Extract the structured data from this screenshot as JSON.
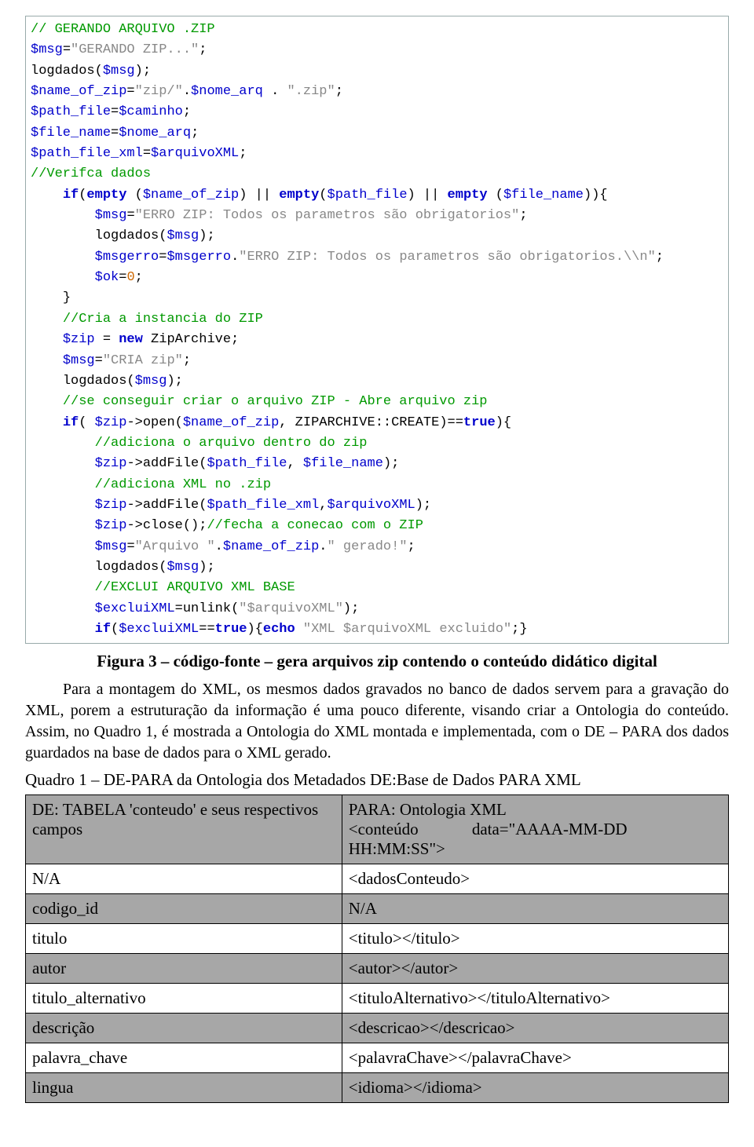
{
  "code_html": "<span class=\"c-comment\">// GERANDO ARQUIVO .ZIP</span>\n<span class=\"c-var\">$msg</span><span class=\"c-plain\">=</span><span class=\"c-str\">\"GERANDO ZIP...\"</span><span class=\"c-plain\">;</span>\n<span class=\"c-plain\">logdados(</span><span class=\"c-var\">$msg</span><span class=\"c-plain\">);</span>\n<span class=\"c-var\">$name_of_zip</span><span class=\"c-plain\">=</span><span class=\"c-str\">\"zip/\"</span><span class=\"c-plain\">.</span><span class=\"c-var\">$nome_arq</span><span class=\"c-plain\"> . </span><span class=\"c-str\">\".zip\"</span><span class=\"c-plain\">;</span>\n<span class=\"c-var\">$path_file</span><span class=\"c-plain\">=</span><span class=\"c-var\">$caminho</span><span class=\"c-plain\">;</span>\n<span class=\"c-var\">$file_name</span><span class=\"c-plain\">=</span><span class=\"c-var\">$nome_arq</span><span class=\"c-plain\">;</span>\n<span class=\"c-var\">$path_file_xml</span><span class=\"c-plain\">=</span><span class=\"c-var\">$arquivoXML</span><span class=\"c-plain\">;</span>\n<span class=\"c-comment\">//Verifca dados</span>\n    <span class=\"c-kw\">if</span><span class=\"c-plain\">(</span><span class=\"c-kw\">empty</span><span class=\"c-plain\"> (</span><span class=\"c-var\">$name_of_zip</span><span class=\"c-plain\">) || </span><span class=\"c-kw\">empty</span><span class=\"c-plain\">(</span><span class=\"c-var\">$path_file</span><span class=\"c-plain\">) || </span><span class=\"c-kw\">empty</span><span class=\"c-plain\"> (</span><span class=\"c-var\">$file_name</span><span class=\"c-plain\">)){</span>\n        <span class=\"c-var\">$msg</span><span class=\"c-plain\">=</span><span class=\"c-str\">\"ERRO ZIP: Todos os parametros são obrigatorios\"</span><span class=\"c-plain\">;</span>\n        <span class=\"c-plain\">logdados(</span><span class=\"c-var\">$msg</span><span class=\"c-plain\">);</span>\n        <span class=\"c-var\">$msgerro</span><span class=\"c-plain\">=</span><span class=\"c-var\">$msgerro</span><span class=\"c-plain\">.</span><span class=\"c-str\">\"ERRO ZIP: Todos os parametros são obrigatorios.\\\\n\"</span><span class=\"c-plain\">;</span>\n        <span class=\"c-var\">$ok</span><span class=\"c-plain\">=</span><span class=\"c-num\">0</span><span class=\"c-plain\">;</span>\n    <span class=\"c-plain\">}</span>\n    <span class=\"c-comment\">//Cria a instancia do ZIP</span>\n    <span class=\"c-var\">$zip</span><span class=\"c-plain\"> = </span><span class=\"c-kw\">new</span><span class=\"c-plain\"> ZipArchive;</span>\n    <span class=\"c-var\">$msg</span><span class=\"c-plain\">=</span><span class=\"c-str\">\"CRIA zip\"</span><span class=\"c-plain\">;</span>\n    <span class=\"c-plain\">logdados(</span><span class=\"c-var\">$msg</span><span class=\"c-plain\">);</span>\n    <span class=\"c-comment\">//se conseguir criar o arquivo ZIP - Abre arquivo zip</span>\n    <span class=\"c-kw\">if</span><span class=\"c-plain\">( </span><span class=\"c-var\">$zip</span><span class=\"c-plain\">-&gt;open(</span><span class=\"c-var\">$name_of_zip</span><span class=\"c-plain\">, ZIPARCHIVE::CREATE)==</span><span class=\"c-kw\">true</span><span class=\"c-plain\">){</span>\n        <span class=\"c-comment\">//adiciona o arquivo dentro do zip</span>\n        <span class=\"c-var\">$zip</span><span class=\"c-plain\">-&gt;addFile(</span><span class=\"c-var\">$path_file</span><span class=\"c-plain\">, </span><span class=\"c-var\">$file_name</span><span class=\"c-plain\">);</span>\n        <span class=\"c-comment\">//adiciona XML no .zip</span>\n        <span class=\"c-var\">$zip</span><span class=\"c-plain\">-&gt;addFile(</span><span class=\"c-var\">$path_file_xml</span><span class=\"c-plain\">,</span><span class=\"c-var\">$arquivoXML</span><span class=\"c-plain\">);</span>\n        <span class=\"c-var\">$zip</span><span class=\"c-plain\">-&gt;close();</span><span class=\"c-comment\">//fecha a conecao com o ZIP</span>\n        <span class=\"c-var\">$msg</span><span class=\"c-plain\">=</span><span class=\"c-str\">\"Arquivo \"</span><span class=\"c-plain\">.</span><span class=\"c-var\">$name_of_zip</span><span class=\"c-plain\">.</span><span class=\"c-str\">\" gerado!\"</span><span class=\"c-plain\">;</span>\n        <span class=\"c-plain\">logdados(</span><span class=\"c-var\">$msg</span><span class=\"c-plain\">);</span>\n        <span class=\"c-comment\">//EXCLUI ARQUIVO XML BASE</span>\n        <span class=\"c-var\">$excluiXML</span><span class=\"c-plain\">=unlink(</span><span class=\"c-str\">\"$arquivoXML\"</span><span class=\"c-plain\">);</span>\n        <span class=\"c-kw\">if</span><span class=\"c-plain\">(</span><span class=\"c-var\">$excluiXML</span><span class=\"c-plain\">==</span><span class=\"c-kw\">true</span><span class=\"c-plain\">){</span><span class=\"c-kw\">echo</span><span class=\"c-plain\"> </span><span class=\"c-str\">\"XML $arquivoXML excluido\"</span><span class=\"c-plain\">;}</span>",
  "fig_caption": "Figura 3 – código-fonte – gera arquivos zip contendo o conteúdo didático digital",
  "paragraph": "Para a montagem do XML, os mesmos dados gravados no banco de dados servem para a gravação do XML, porem a estruturação da informação é uma pouco diferente, visando criar a Ontologia do conteúdo. Assim, no Quadro 1, é mostrada a Ontologia do XML montada e implementada, com o DE – PARA dos dados guardados na base de dados para o XML gerado.",
  "quadro_title": "Quadro 1 – DE-PARA da Ontologia dos Metadados DE:Base de Dados PARA XML",
  "table": {
    "rows": [
      {
        "shaded": true,
        "left": "DE: TABELA 'conteudo' e seus respectivos campos",
        "right_html": "PARA: Ontologia XML<br>&lt;conteúdo&nbsp;&nbsp;&nbsp;&nbsp;&nbsp;&nbsp;&nbsp;&nbsp;&nbsp;&nbsp;&nbsp;&nbsp;&nbsp;data=\"AAAA-MM-DD HH:MM:SS\"&gt;"
      },
      {
        "shaded": false,
        "left": "N/A",
        "right": "<dadosConteudo>"
      },
      {
        "shaded": true,
        "left": "codigo_id",
        "right": "N/A"
      },
      {
        "shaded": false,
        "left": "titulo",
        "right": "<titulo></titulo>"
      },
      {
        "shaded": true,
        "left": "autor",
        "right": "<autor></autor>"
      },
      {
        "shaded": false,
        "left": "titulo_alternativo",
        "right": "<tituloAlternativo></tituloAlternativo>"
      },
      {
        "shaded": true,
        "left": "descrição",
        "right": "<descricao></descricao>"
      },
      {
        "shaded": false,
        "left": "palavra_chave",
        "right": "<palavraChave></palavraChave>"
      },
      {
        "shaded": true,
        "left": "lingua",
        "right": "<idioma></idioma>"
      }
    ]
  }
}
